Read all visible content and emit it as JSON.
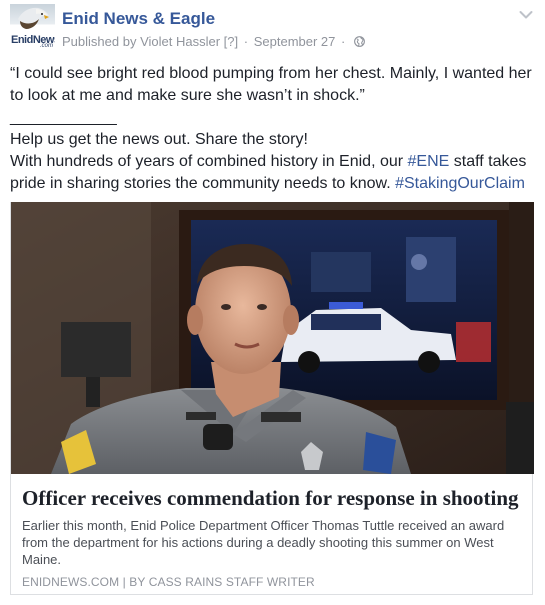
{
  "header": {
    "page_name": "Enid News & Eagle",
    "published_prefix": "Published by",
    "publisher": "Violet Hassler",
    "help_mark": "[?]",
    "separator": "·",
    "date": "September 27",
    "avatar_logo_text": "EnidNews",
    "avatar_logo_sub": ".com"
  },
  "post": {
    "quote": "“I could see bright red blood pumping from her chest. Mainly, I wanted her to look at me and make sure she wasn’t in shock.”",
    "divider": "____________",
    "line1": "Help us get the news out. Share the story!",
    "line2_a": "With hundreds of years of combined history in Enid, our ",
    "hashtag1": "#ENE",
    "line2_b": " staff takes pride in sharing stories the community needs to know. ",
    "hashtag2": "#StakingOurClaim"
  },
  "link_card": {
    "title": "Officer receives commendation for response in shooting",
    "description": "Earlier this month, Enid Police Department Officer Thomas Tuttle received an award from the department for his actions during a deadly shooting this summer on West Maine.",
    "source": "ENIDNEWS.COM | BY CASS RAINS STAFF WRITER",
    "image_alt": "Officer in uniform seated in front of a framed police car picture"
  },
  "colors": {
    "link": "#365899",
    "text": "#1d2129",
    "meta": "#90949c",
    "border": "#dddfe2"
  },
  "icons": {
    "privacy": "globe-icon",
    "menu": "chevron-down-icon"
  }
}
